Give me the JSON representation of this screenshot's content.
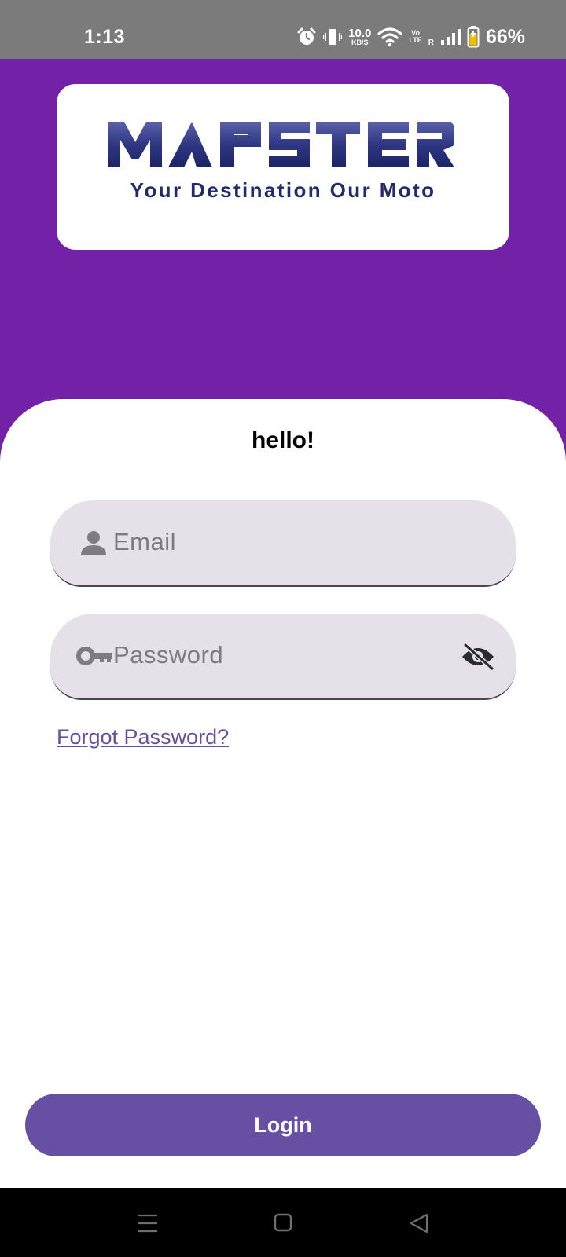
{
  "status_bar": {
    "time": "1:13",
    "net_speed_value": "10.0",
    "net_speed_unit": "KB/S",
    "volte_top": "Vo",
    "volte_bottom": "LTE",
    "roaming": "R",
    "battery_percent": "66%"
  },
  "logo": {
    "brand": "MAPSTER",
    "tagline": "Your Destination Our Moto"
  },
  "form": {
    "greeting": "hello!",
    "email_placeholder": "Email",
    "email_value": "",
    "password_placeholder": "Password",
    "password_value": "",
    "forgot_label": "Forgot Password?",
    "login_label": "Login"
  },
  "colors": {
    "header_purple": "#7321a6",
    "button_purple": "#6750a4",
    "field_fill": "#e6e1e8",
    "logo_navy": "#222c6b"
  },
  "icons": {
    "email_field": "person-icon",
    "password_field": "key-icon",
    "password_toggle": "eye-off-icon"
  }
}
